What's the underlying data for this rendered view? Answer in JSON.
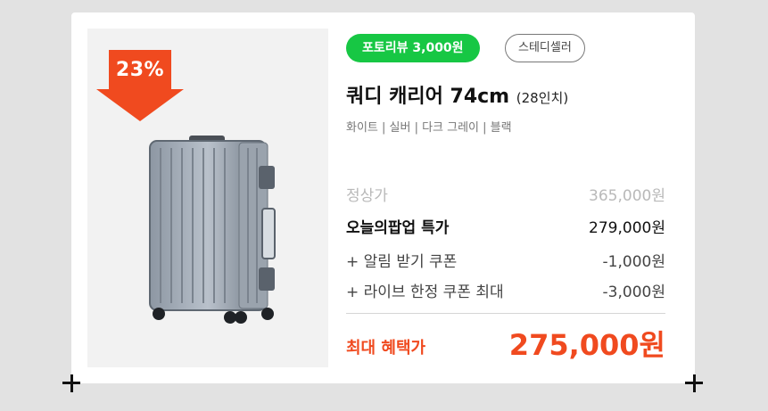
{
  "badges": {
    "review": "포토리뷰  3,000원",
    "seller": "스테디셀러"
  },
  "product": {
    "discount": "23%",
    "title": "쿼디 캐리어 74cm",
    "size": "(28인치)",
    "colors": "화이트 | 실버 | 다크 그레이 | 블랙"
  },
  "pricing": {
    "original": {
      "label": "정상가",
      "value": "365,000원"
    },
    "sale": {
      "label": "오늘의팝업 특가",
      "value": "279,000원"
    },
    "coupon_alarm": {
      "label": "+ 알림 받기 쿠폰",
      "value": "-1,000원"
    },
    "coupon_live": {
      "label": "+ 라이브 한정 쿠폰 최대",
      "value": "-3,000원"
    },
    "final": {
      "label": "최대 혜택가",
      "value": "275,000원"
    }
  },
  "colors": {
    "accent": "#f04a1f",
    "badge_green": "#17c744"
  },
  "icons": {
    "discount": "down-arrow-icon",
    "add": "plus-icon"
  }
}
